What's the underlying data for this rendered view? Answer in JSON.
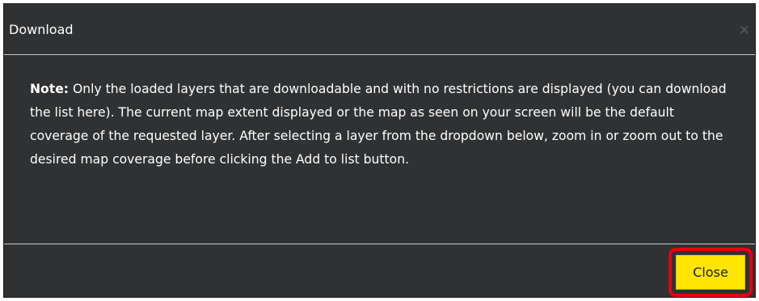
{
  "dialog": {
    "title": "Download",
    "close_icon": "close-icon",
    "note_label": "Note:",
    "note_text": " Only the loaded layers that are downloadable and with no restrictions are displayed (you can download the list here). The current map extent displayed or the map as seen on your screen will be the default coverage of the requested layer. After selecting a layer from the dropdown below, zoom in or zoom out to the desired map coverage before clicking the Add to list button.",
    "close_button_label": "Close"
  },
  "colors": {
    "dialog_background": "#2f3133",
    "close_button": "#ffe600",
    "highlight_outline": "#e8000b"
  }
}
